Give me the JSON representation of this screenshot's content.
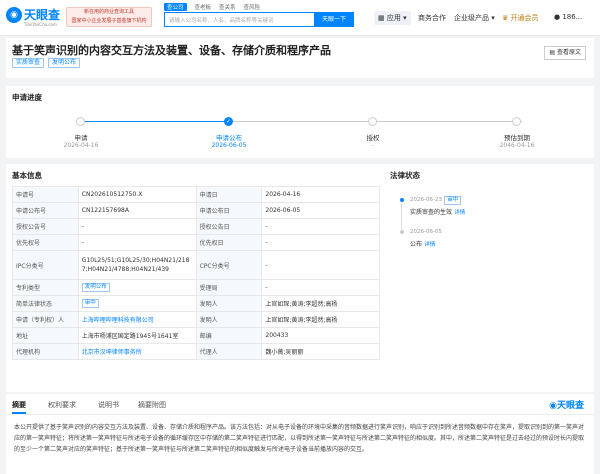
{
  "header": {
    "logo_text": "天眼查",
    "logo_domain": "TianYanCha.com",
    "promo_lines": [
      "新在用的商业查询工具",
      "国家中小企业发展子基金旗下机构"
    ],
    "search_tabs": [
      "查公司",
      "查老板",
      "查关系",
      "查风险"
    ],
    "search_placeholder": "请输入公司名称、人名、品牌名称等关键词",
    "search_button": "天眼一下",
    "nav": {
      "app": "应用",
      "business": "商务合作",
      "enterprise": "企业级产品",
      "vip": "开通会员",
      "user": "186..."
    }
  },
  "patent": {
    "title": "基于笑声识别的内容交互方法及装置、设备、存储介质和程序产品",
    "tags": [
      "实质审查",
      "发明公布"
    ],
    "view_original": "查看原文"
  },
  "progress": {
    "section_title": "申请进度",
    "steps": [
      {
        "label": "申请",
        "date": "2026-04-16",
        "state": "done"
      },
      {
        "label": "申请公布",
        "date": "2026-06-05",
        "state": "current"
      },
      {
        "label": "授权",
        "date": "-",
        "state": "todo"
      },
      {
        "label": "预估到期",
        "date": "2046-04-16",
        "state": "todo"
      }
    ]
  },
  "basic": {
    "section_title": "基本信息",
    "rows": [
      {
        "k1": "申请号",
        "v1": "CN202610512750.X",
        "k2": "申请日",
        "v2": "2026-04-16"
      },
      {
        "k1": "申请公布号",
        "v1": "CN122157698A",
        "k2": "申请公布日",
        "v2": "2026-06-05"
      },
      {
        "k1": "授权公告号",
        "v1": "-",
        "k2": "授权公告日",
        "v2": "-"
      },
      {
        "k1": "优先权号",
        "v1": "-",
        "k2": "优先权日",
        "v2": "-"
      },
      {
        "k1": "IPC分类号",
        "v1": "G10L25/51;G10L25/30;H04N21/2187;H04N21/4788;H04N21/439",
        "k2": "CPC分类号",
        "v2": "-"
      },
      {
        "k1": "专利类型",
        "v1": "发明公布",
        "k2": "受理局",
        "v2": "-"
      },
      {
        "k1": "简单法律状态",
        "v1": "审中",
        "k2": "发明人",
        "v2": "上官如琛;黄涛;李超然;高杨"
      },
      {
        "k1": "申请（专利权）人",
        "v1": "上海哔哩哔哩科技有限公司",
        "k2": "发明人",
        "v2": "上官如琛;黄涛;李超然;高杨"
      },
      {
        "k1": "地址",
        "v1": "上海市杨浦区国定路1945号1641室",
        "k2": "邮编",
        "v2": "200433"
      },
      {
        "k1": "代理机构",
        "v1": "北京市汉坤律师事务所",
        "k2": "代理人",
        "v2": "魏小薇;吴丽丽"
      }
    ]
  },
  "legal": {
    "section_title": "法律状态",
    "events": [
      {
        "date": "2026-06-23",
        "badge": "审中",
        "text": "实质审查的生效",
        "more": "详情"
      },
      {
        "date": "2026-06-05",
        "badge": "",
        "text": "公布",
        "more": "详情"
      }
    ]
  },
  "abstract": {
    "tabs": [
      "摘要",
      "权利要求",
      "说明书",
      "摘要附图"
    ],
    "watermark": "天眼查",
    "text": "本公开提供了基于笑声识别的内容交互方法及装置、设备、存储介质和程序产品。该方法包括：对从电子设备的环境中采集的音频数据进行笑声识别，响应于识别到所述音频数据中存在笑声，提取识别到的第一笑声对应的第一笑声特征；将所述第一笑声特征与所述电子设备的循环缓存区中存储的第二笑声特征进行匹配，以得到所述第一笑声特征与所述第二笑声特征的相似度。其中，所述第二笑声特征是过去经过的预设时长内提取的至少一个第二笑声对应的笑声特征；基于所述第一笑声特征与所述第二笑声特征的相似度触发与所述电子设备当前播放内容的交互。"
  }
}
